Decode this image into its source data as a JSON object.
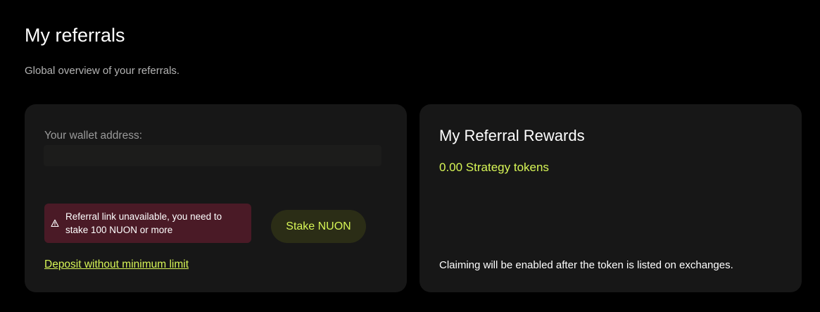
{
  "header": {
    "title": "My referrals",
    "subtitle": "Global overview of your referrals."
  },
  "wallet_card": {
    "wallet_label": "Your wallet address:",
    "wallet_value": "",
    "warning_icon": "warning-triangle-icon",
    "warning_text": "Referral link unavailable, you need to stake 100 NUON or more",
    "stake_button_label": "Stake NUON",
    "deposit_link_label": "Deposit without minimum limit"
  },
  "rewards_card": {
    "title": "My Referral Rewards",
    "value": "0.00 Strategy tokens",
    "note": "Claiming will be enabled after the token is listed on exchanges."
  },
  "colors": {
    "background": "#000000",
    "card": "#171717",
    "accent": "#d7f556",
    "warning_bg": "#4a1a26",
    "button_bg": "#2b2d16"
  }
}
